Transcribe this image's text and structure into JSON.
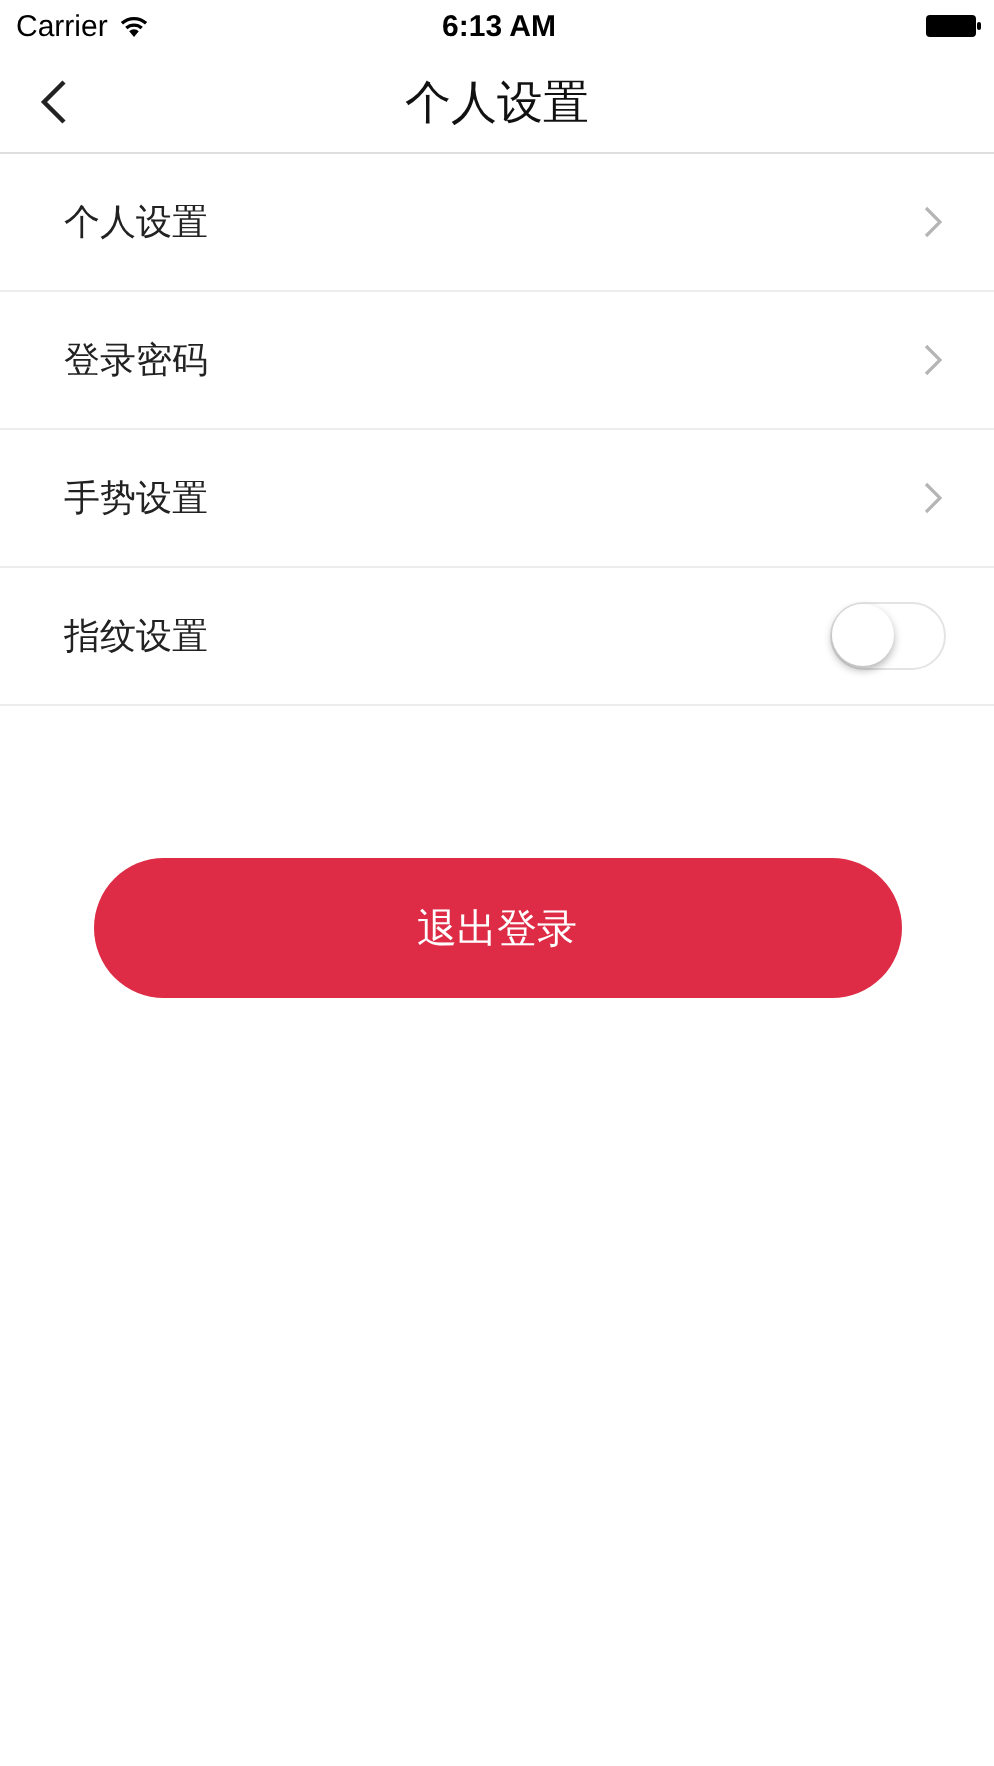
{
  "status_bar": {
    "carrier": "Carrier",
    "time": "6:13 AM"
  },
  "nav": {
    "title": "个人设置"
  },
  "settings": [
    {
      "label": "个人设置",
      "kind": "link"
    },
    {
      "label": "登录密码",
      "kind": "link"
    },
    {
      "label": "手势设置",
      "kind": "link"
    },
    {
      "label": "指纹设置",
      "kind": "toggle",
      "on": false
    }
  ],
  "logout_button": "退出登录"
}
